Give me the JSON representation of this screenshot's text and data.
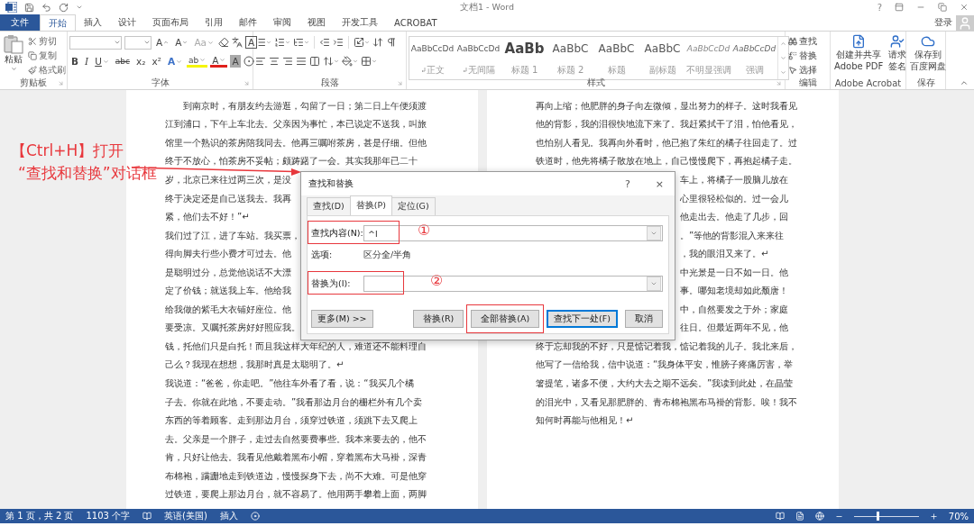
{
  "title_bar": {
    "title": "文档1 - Word",
    "help": "?"
  },
  "tabs": [
    {
      "label": "文件",
      "kind": "file",
      "selected": false
    },
    {
      "label": "开始",
      "kind": "tab",
      "selected": true
    },
    {
      "label": "插入",
      "kind": "tab",
      "selected": false
    },
    {
      "label": "设计",
      "kind": "tab",
      "selected": false
    },
    {
      "label": "页面布局",
      "kind": "tab",
      "selected": false
    },
    {
      "label": "引用",
      "kind": "tab",
      "selected": false
    },
    {
      "label": "邮件",
      "kind": "tab",
      "selected": false
    },
    {
      "label": "审阅",
      "kind": "tab",
      "selected": false
    },
    {
      "label": "视图",
      "kind": "tab",
      "selected": false
    },
    {
      "label": "开发工具",
      "kind": "tab",
      "selected": false
    },
    {
      "label": "ACROBAT",
      "kind": "tab",
      "selected": false
    }
  ],
  "account": {
    "label": "登录"
  },
  "ribbon": {
    "clipboard": {
      "label": "剪贴板",
      "paste": "粘贴",
      "commands": [
        {
          "label": "剪切",
          "kind": "cut"
        },
        {
          "label": "复制",
          "kind": "copy"
        },
        {
          "label": "格式刷",
          "kind": "painter"
        }
      ]
    },
    "font": {
      "label": "字体",
      "row1": [
        {
          "label": "A",
          "kind": "grow"
        },
        {
          "label": "A",
          "kind": "shrink"
        },
        {
          "label": "Aa",
          "kind": "case"
        },
        {
          "kind": "clear"
        },
        {
          "kind": "phonetic"
        },
        {
          "label": "A",
          "kind": "boxed"
        }
      ],
      "row2": [
        {
          "label": "B",
          "kind": "bold"
        },
        {
          "label": "I",
          "kind": "italic"
        },
        {
          "label": "U",
          "kind": "underline"
        },
        {
          "label": "abc",
          "kind": "strike"
        },
        {
          "label": "x₂",
          "kind": "sub"
        },
        {
          "label": "x²",
          "kind": "super"
        },
        {
          "label": "A",
          "kind": "effect"
        },
        {
          "label": "ab",
          "kind": "highlight"
        },
        {
          "label": "A",
          "kind": "color"
        },
        {
          "label": "A",
          "kind": "shade"
        },
        {
          "kind": "enclose"
        }
      ]
    },
    "paragraph": {
      "label": "段落"
    },
    "styles": {
      "label": "样式",
      "items": [
        {
          "sample": "AaBbCcDd",
          "name": "正文",
          "kind": "body",
          "mark": true
        },
        {
          "sample": "AaBbCcDd",
          "name": "无间隔",
          "kind": "body",
          "mark": true
        },
        {
          "sample": "AaBb",
          "name": "标题 1",
          "kind": "h1",
          "mark": false
        },
        {
          "sample": "AaBbC",
          "name": "标题 2",
          "kind": "h2",
          "mark": false
        },
        {
          "sample": "AaBbC",
          "name": "标题",
          "kind": "h2",
          "mark": false
        },
        {
          "sample": "AaBbC",
          "name": "副标题",
          "kind": "h2",
          "mark": false
        },
        {
          "sample": "AaBbCcDd",
          "name": "不明显强调",
          "kind": "subtle",
          "mark": false
        },
        {
          "sample": "AaBbCcDd",
          "name": "强调",
          "kind": "emphasis",
          "mark": false
        }
      ]
    },
    "editing": {
      "label": "编辑",
      "commands": [
        {
          "label": "查找",
          "kind": "find"
        },
        {
          "label": "替换",
          "kind": "replace"
        },
        {
          "label": "选择",
          "kind": "select"
        }
      ]
    },
    "acrobat": {
      "label": "Adobe Acrobat",
      "commands": [
        {
          "lines": [
            "创建并共享",
            "Adobe PDF"
          ],
          "kind": "pdf"
        },
        {
          "lines": [
            "请求",
            "签名"
          ],
          "kind": "sign"
        }
      ]
    },
    "save": {
      "label": "保存",
      "commands": [
        {
          "lines": [
            "保存到",
            "百度网盘"
          ],
          "kind": "cloud"
        }
      ]
    }
  },
  "pages": [
    {
      "lines": [
        {
          "text": "到南京时，有朋友约去游逛，勾留了一日；第二日上午便须渡",
          "kind": "indent"
        },
        {
          "text": "江到浦口，下午上车北去。父亲因为事忙，本已说定不送我，叫旅",
          "kind": "full"
        },
        {
          "text": "馆里一个熟识的茶房陪我同去。他再三嘱咐茶房，甚是仔细。但他",
          "kind": "full"
        },
        {
          "text": "终于不放心，怕茶房不妥帖；颇踌躇了一会。其实我那年已二十",
          "kind": "full"
        },
        {
          "text": "岁，北京已来往过两三次，是没",
          "kind": "full"
        },
        {
          "text": "终于决定还是自己送我去。我再",
          "kind": "full"
        },
        {
          "text": "紧，他们去不好！”↵",
          "kind": "full"
        },
        {
          "text": "我们过了江，进了车站。我买票，",
          "kind": "full"
        },
        {
          "text": "得向脚夫行些小费才可过去。他",
          "kind": "full"
        },
        {
          "text": "是聪明过分，总觉他说话不大漂",
          "kind": "full"
        },
        {
          "text": "定了价钱；就送我上车。他给我",
          "kind": "full"
        },
        {
          "text": "给我做的紫毛大衣铺好座位。他",
          "kind": "full"
        },
        {
          "text": "要受凉。又嘱托茶房好好照应我。",
          "kind": "full"
        },
        {
          "text": "钱，托他们只是白托！而且我这样大年纪的人，难道还不能料理自",
          "kind": "full"
        },
        {
          "text": "己么？我现在想想，我那时真是太聪明了。↵",
          "kind": "full"
        },
        {
          "text": "我说道：“爸爸，你走吧。”他往车外看了看，说：“我买几个橘",
          "kind": "full"
        },
        {
          "text": "子去。你就在此地，不要走动。”我看那边月台的栅栏外有几个卖",
          "kind": "full"
        },
        {
          "text": "东西的等着顾客。走到那边月台，须穿过铁道，须跳下去又爬上",
          "kind": "full"
        },
        {
          "text": "去。父亲是一个胖子，走过去自然要费事些。我本来要去的，他不",
          "kind": "full"
        },
        {
          "text": "肯，只好让他去。我看见他戴着黑布小帽，穿着黑布大马褂，深青",
          "kind": "full"
        },
        {
          "text": "布棉袍，蹒跚地走到铁道边，慢慢探身下去，尚不大难。可是他穿",
          "kind": "full"
        },
        {
          "text": "过铁道，要爬上那边月台，就不容易了。他用两手攀着上面，两脚",
          "kind": "full"
        }
      ]
    },
    {
      "lines": [
        {
          "text": "再向上缩；他肥胖的身子向左微倾，显出努力的样子。这时我看见",
          "kind": "full"
        },
        {
          "text": "他的背影，我的泪很快地流下来了。我赶紧拭干了泪，怕他看见，",
          "kind": "full"
        },
        {
          "text": "也怕别人看见。我再向外看时，他已抱了朱红的橘子往回走了。过",
          "kind": "full"
        },
        {
          "text": "铁道时，他先将橘子散放在地上，自己慢慢爬下，再抱起橘子走。",
          "kind": "full"
        },
        {
          "text": "车上，将橘子一股脑儿放在",
          "kind": "tail"
        },
        {
          "text": "心里很轻松似的。过一会儿",
          "kind": "tail"
        },
        {
          "text": "他走出去。他走了几步，回",
          "kind": "tail"
        },
        {
          "text": "。”等他的背影混入来来往",
          "kind": "tail"
        },
        {
          "text": "，我的眼泪又来了。↵",
          "kind": "tail"
        },
        {
          "text": "中光景是一日不如一日。他",
          "kind": "tail"
        },
        {
          "text": "事。哪知老境却如此颓唐！",
          "kind": "tail"
        },
        {
          "text": "中，自然要发之于外；家庭",
          "kind": "tail"
        },
        {
          "text": "往日。但最近两年不见，他",
          "kind": "tail"
        },
        {
          "text": "终于忘却我的不好，只是惦记着我，惦记着我的儿子。我北来后，",
          "kind": "full"
        },
        {
          "text": "他写了一信给我，信中说道：“我身体平安，惟膀子疼痛厉害，举",
          "kind": "full"
        },
        {
          "text": "箸提笔，诸多不便，大约大去之期不远矣。”我读到此处，在晶莹",
          "kind": "full"
        },
        {
          "text": "的泪光中，又看见那肥胖的、青布棉袍黑布马褂的背影。唉！我不",
          "kind": "full"
        },
        {
          "text": "知何时再能与他相见！↵",
          "kind": "full"
        }
      ]
    }
  ],
  "callout": {
    "lines": [
      "【Ctrl+H】打开",
      "“查找和替换”对话框"
    ]
  },
  "dialog": {
    "title": "查找和替换",
    "help": "?",
    "close": "×",
    "tabs": [
      {
        "label": "查找(D)",
        "selected": false
      },
      {
        "label": "替换(P)",
        "selected": true
      },
      {
        "label": "定位(G)",
        "selected": false
      }
    ],
    "find": {
      "label": "查找内容(N):",
      "value": "^l",
      "highlighted": true,
      "marker": "①"
    },
    "options": {
      "label": "选项:",
      "value": "区分全/半角"
    },
    "replace": {
      "label": "替换为(I):",
      "highlighted": true,
      "marker": "②"
    },
    "buttons": [
      {
        "label": "更多(M) >>",
        "kind": "more",
        "highlighted": false
      },
      {
        "label": "替换(R)",
        "kind": "normal",
        "highlighted": false
      },
      {
        "label": "全部替换(A)",
        "kind": "normal",
        "highlighted": true
      },
      {
        "label": "查找下一处(F)",
        "kind": "default",
        "highlighted": false
      },
      {
        "label": "取消",
        "kind": "normal",
        "highlighted": false
      }
    ]
  },
  "status_bar": {
    "page": "第 1 页，共 2 页",
    "words": "1103 个字",
    "language": "英语(美国)",
    "mode": "插入",
    "zoom": {
      "level": 0.36,
      "reading": "70%"
    }
  }
}
